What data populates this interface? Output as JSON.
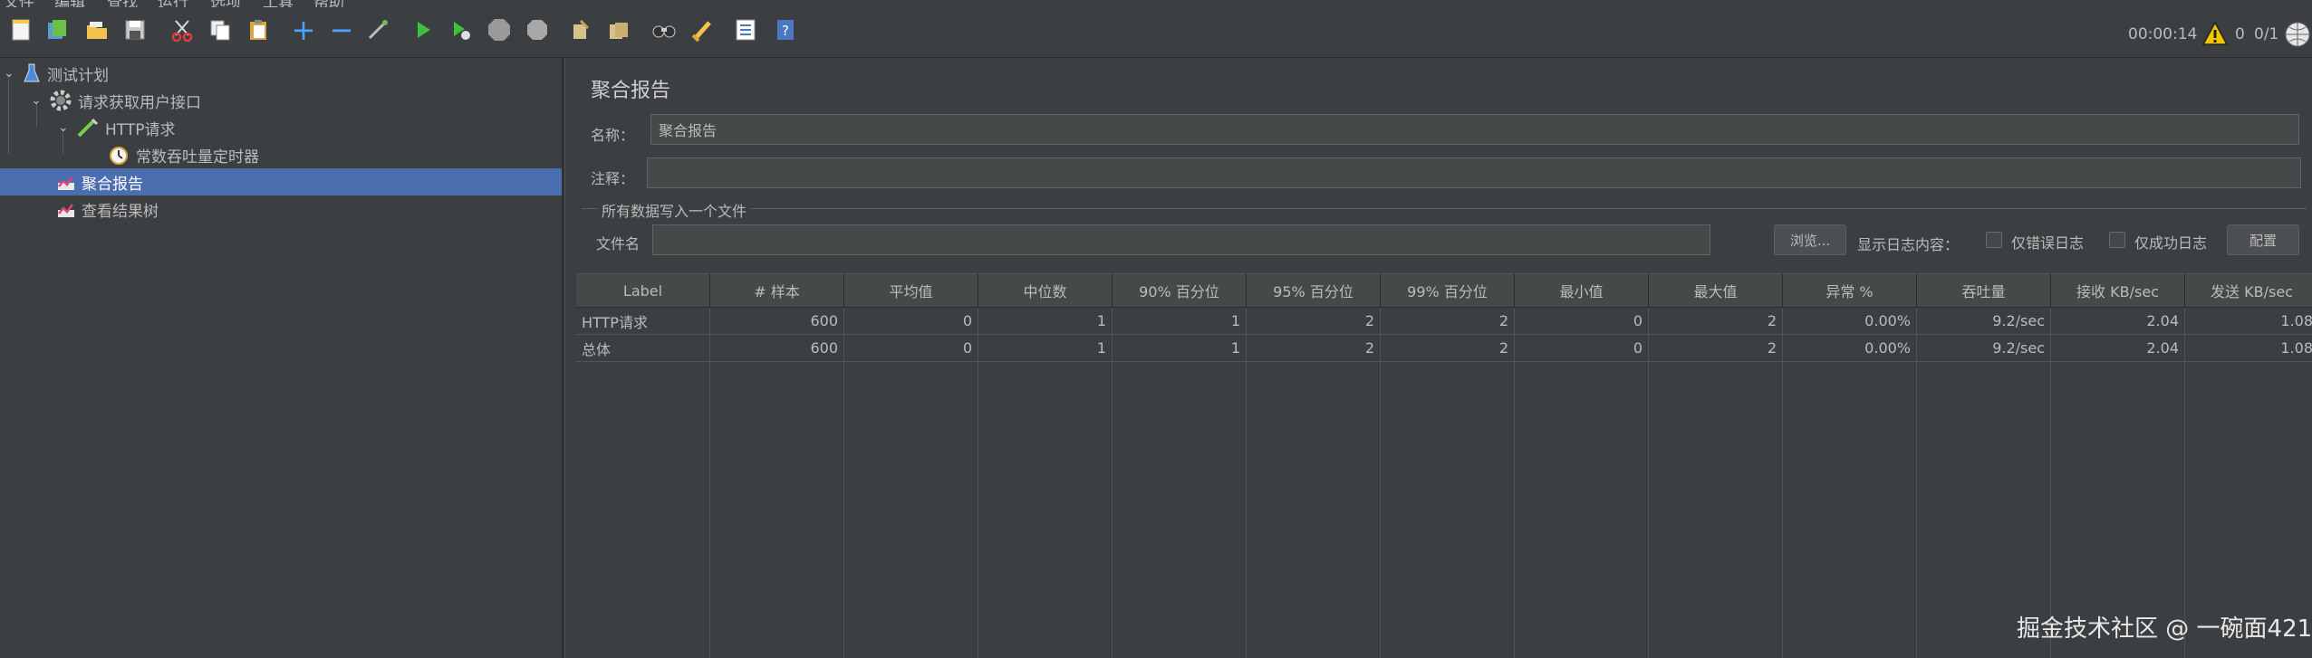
{
  "menu": [
    "文件",
    "编辑",
    "查找",
    "运行",
    "选项",
    "工具",
    "帮助"
  ],
  "toolbar": {
    "icons": [
      "new-icon",
      "templates-icon",
      "open-icon",
      "save-icon",
      "cut-icon",
      "copy-icon",
      "paste-icon",
      "expand-icon",
      "collapse-icon",
      "toggle-icon",
      "start-icon",
      "start-no-pause-icon",
      "stop-icon",
      "shutdown-icon",
      "clear-icon",
      "clear-all-icon",
      "search-icon",
      "reset-search-icon",
      "function-helper-icon",
      "help-icon"
    ],
    "timer": "00:00:14",
    "error_count": "0",
    "threads": "0/1"
  },
  "tree": {
    "items": [
      {
        "label": "测试计划",
        "icon": "test-plan-icon"
      },
      {
        "label": "请求获取用户接口",
        "icon": "thread-group-gear-icon"
      },
      {
        "label": "HTTP请求",
        "icon": "http-sampler-pipette-icon"
      },
      {
        "label": "常数吞吐量定时器",
        "icon": "timer-stopwatch-icon"
      },
      {
        "label": "聚合报告",
        "icon": "report-chart-icon",
        "selected": true
      },
      {
        "label": "查看结果树",
        "icon": "report-chart-icon"
      }
    ]
  },
  "panel": {
    "title": "聚合报告",
    "name_label": "名称：",
    "name_value": "聚合报告",
    "comment_label": "注释：",
    "comment_value": "",
    "group_title": "所有数据写入一个文件",
    "file_label": "文件名",
    "file_value": "",
    "browse_label": "浏览...",
    "log_label": "显示日志内容：",
    "errors_only_label": "仅错误日志",
    "success_only_label": "仅成功日志",
    "configure_label": "配置"
  },
  "table": {
    "columns": [
      "Label",
      "# 样本",
      "平均值",
      "中位数",
      "90% 百分位",
      "95% 百分位",
      "99% 百分位",
      "最小值",
      "最大值",
      "异常 %",
      "吞吐量",
      "接收 KB/sec",
      "发送 KB/sec"
    ],
    "rows": [
      [
        "HTTP请求",
        "600",
        "0",
        "1",
        "1",
        "2",
        "2",
        "0",
        "2",
        "0.00%",
        "9.2/sec",
        "2.04",
        "1.08"
      ],
      [
        "总体",
        "600",
        "0",
        "1",
        "1",
        "2",
        "2",
        "0",
        "2",
        "0.00%",
        "9.2/sec",
        "2.04",
        "1.08"
      ]
    ]
  },
  "watermark": "掘金技术社区 @ 一碗面421"
}
